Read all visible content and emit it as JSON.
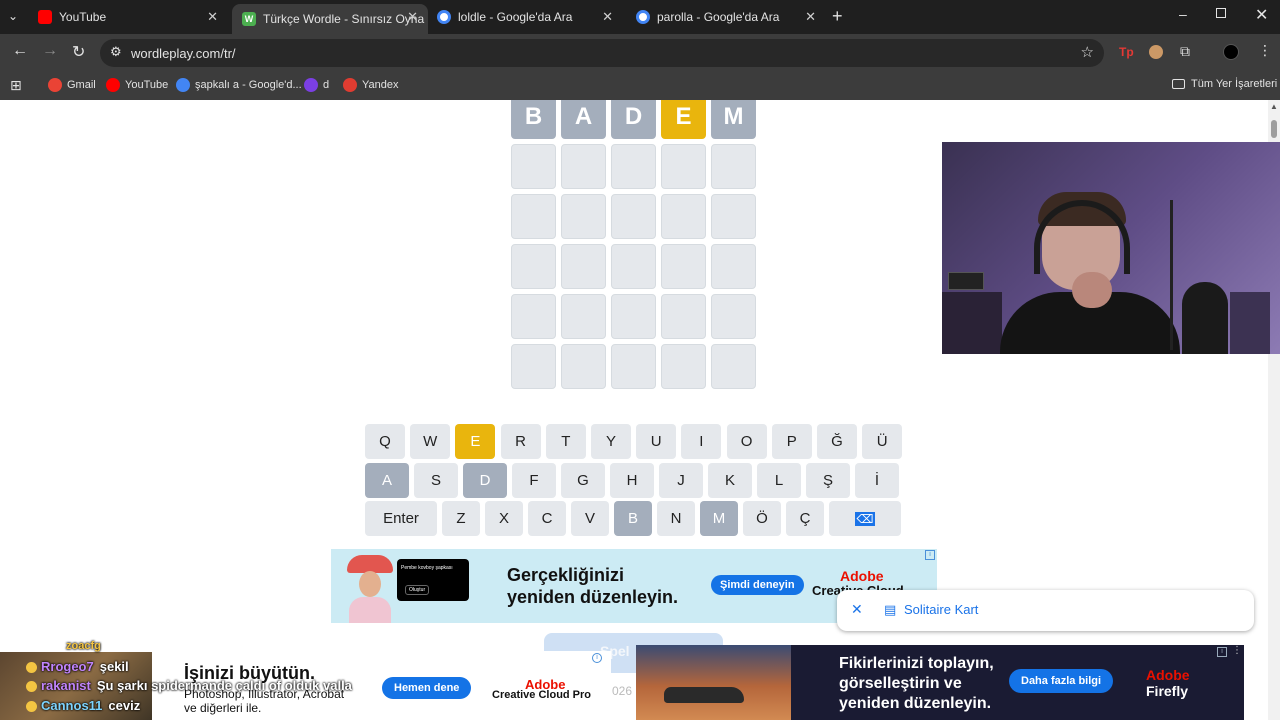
{
  "browser": {
    "tabs": [
      {
        "label": "YouTube",
        "icon": "youtube-icon",
        "color": "#ff0000"
      },
      {
        "label": "Türkçe Wordle - Sınırsız Oyna",
        "icon": "wordle-icon",
        "color": "#4caf50",
        "badge": "W"
      },
      {
        "label": "loldle - Google'da Ara",
        "icon": "google-icon",
        "color": "#4285f4"
      },
      {
        "label": "parolla - Google'da Ara",
        "icon": "google-icon",
        "color": "#4285f4"
      }
    ],
    "url": "wordleplay.com/tr/",
    "bookmarks": [
      {
        "label": "Gmail",
        "color": "#ea4335"
      },
      {
        "label": "YouTube",
        "color": "#ff0000"
      },
      {
        "label": "şapkalı a - Google'd...",
        "color": "#4285f4"
      },
      {
        "label": "d",
        "color": "#7b3fe4"
      },
      {
        "label": "Yandex",
        "color": "#e03c31"
      }
    ],
    "all_bookmarks": "Tüm Yer İşaretleri"
  },
  "game": {
    "rows": [
      [
        {
          "l": "B",
          "s": "absent"
        },
        {
          "l": "A",
          "s": "absent"
        },
        {
          "l": "D",
          "s": "absent"
        },
        {
          "l": "E",
          "s": "present"
        },
        {
          "l": "M",
          "s": "absent"
        }
      ],
      [
        {
          "l": "",
          "s": "empty"
        },
        {
          "l": "",
          "s": "empty"
        },
        {
          "l": "",
          "s": "empty"
        },
        {
          "l": "",
          "s": "empty"
        },
        {
          "l": "",
          "s": "empty"
        }
      ],
      [
        {
          "l": "",
          "s": "empty"
        },
        {
          "l": "",
          "s": "empty"
        },
        {
          "l": "",
          "s": "empty"
        },
        {
          "l": "",
          "s": "empty"
        },
        {
          "l": "",
          "s": "empty"
        }
      ],
      [
        {
          "l": "",
          "s": "empty"
        },
        {
          "l": "",
          "s": "empty"
        },
        {
          "l": "",
          "s": "empty"
        },
        {
          "l": "",
          "s": "empty"
        },
        {
          "l": "",
          "s": "empty"
        }
      ],
      [
        {
          "l": "",
          "s": "empty"
        },
        {
          "l": "",
          "s": "empty"
        },
        {
          "l": "",
          "s": "empty"
        },
        {
          "l": "",
          "s": "empty"
        },
        {
          "l": "",
          "s": "empty"
        }
      ],
      [
        {
          "l": "",
          "s": "empty"
        },
        {
          "l": "",
          "s": "empty"
        },
        {
          "l": "",
          "s": "empty"
        },
        {
          "l": "",
          "s": "empty"
        },
        {
          "l": "",
          "s": "empty"
        }
      ]
    ],
    "keyboard": [
      [
        {
          "k": "Q"
        },
        {
          "k": "W"
        },
        {
          "k": "E",
          "s": "present"
        },
        {
          "k": "R"
        },
        {
          "k": "T"
        },
        {
          "k": "Y"
        },
        {
          "k": "U"
        },
        {
          "k": "I"
        },
        {
          "k": "O"
        },
        {
          "k": "P"
        },
        {
          "k": "Ğ"
        },
        {
          "k": "Ü"
        }
      ],
      [
        {
          "k": "A",
          "s": "absent"
        },
        {
          "k": "S"
        },
        {
          "k": "D",
          "s": "absent"
        },
        {
          "k": "F"
        },
        {
          "k": "G"
        },
        {
          "k": "H"
        },
        {
          "k": "J"
        },
        {
          "k": "K"
        },
        {
          "k": "L"
        },
        {
          "k": "Ş"
        },
        {
          "k": "İ"
        }
      ],
      [
        {
          "k": "Enter",
          "wide": true
        },
        {
          "k": "Z"
        },
        {
          "k": "X"
        },
        {
          "k": "C"
        },
        {
          "k": "V"
        },
        {
          "k": "B",
          "s": "absent"
        },
        {
          "k": "N"
        },
        {
          "k": "M",
          "s": "absent"
        },
        {
          "k": "Ö"
        },
        {
          "k": "Ç"
        },
        {
          "k": "⌫",
          "wide": true,
          "icon": "backspace-icon"
        }
      ]
    ]
  },
  "ads": {
    "top": {
      "line1": "Gerçekliğinizi",
      "line2": "yeniden düzenleyin.",
      "cta": "Şimdi deneyin",
      "brand": "Adobe",
      "product": "Creative Cloud",
      "small_ui_1": "Pembe kovboy şapkası",
      "small_ui_2": "Oluştur"
    },
    "bottom_left": {
      "headline": "İşinizi büyütün.",
      "body": "Photoshop, Illustrator, Acrobat ve diğerleri ile.",
      "cta": "Hemen dene",
      "brand": "Adobe",
      "product": "Creative Cloud Pro"
    },
    "bottom_right": {
      "line1": "Fikirlerinizi toplayın,",
      "line2": "görselleştirin ve",
      "line3": "yeniden düzenleyin.",
      "cta": "Daha fazla bilgi",
      "brand": "Adobe",
      "product": "Firefly"
    }
  },
  "popup": {
    "label": "Solitaire Kart"
  },
  "chat": [
    {
      "user": "zoacfg",
      "msg": ""
    },
    {
      "user": "Rrogeo7",
      "msg": "şekil"
    },
    {
      "user": "rakanist",
      "msg": "Şu şarkı spidermande çaldı of olduk valla"
    },
    {
      "user": "Cannos11",
      "msg": "ceviz"
    }
  ],
  "partial_behind": {
    "play_label": "Spel",
    "year": "026"
  }
}
